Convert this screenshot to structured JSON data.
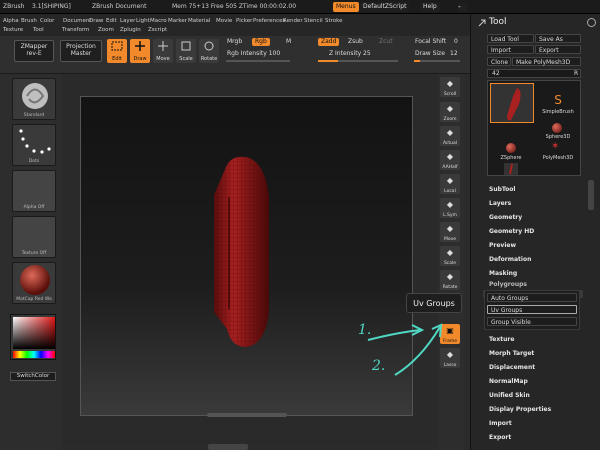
{
  "titlebar": {
    "app": "ZBrush",
    "version": "3.1[SHIPING]",
    "document": "ZBrush Document",
    "mem": "Mem 75+13 Free 505 ZTime 00:00:02.00",
    "menus_label": "Menus",
    "script_label": "DefaultZScript",
    "help_label": "Help"
  },
  "menubar": {
    "row1": [
      "Alpha",
      "Brush",
      "Color",
      "Document",
      "Draw",
      "Edit",
      "Layer",
      "Light",
      "Macro",
      "Marker",
      "Material",
      "Movie",
      "Picker",
      "Preferences",
      "Render",
      "Stencil",
      "Stroke"
    ],
    "row2": [
      "Texture",
      "Tool",
      "Transform",
      "Zoom",
      "Zplugin",
      "Zscript"
    ]
  },
  "toolbar": {
    "zmapper": "ZMapper",
    "zmapper_rev": "rev-E",
    "projection": "Projection",
    "projection2": "Master",
    "edit": "Edit",
    "draw": "Draw",
    "move": "Move",
    "scale": "Scale",
    "rotate": "Rotate",
    "mrgb": "Mrgb",
    "rgb": "Rgb",
    "m": "M",
    "rgb_intensity": "Rgb Intensity 100",
    "zadd": "Zadd",
    "zsub": "Zsub",
    "zcut": "Zcut",
    "z_intensity": "Z Intensity 25",
    "focal_shift": "Focal Shift",
    "focal_shift_val": "0",
    "draw_size": "Draw Size",
    "draw_size_val": "12"
  },
  "leftshelf": {
    "brush": "Standard",
    "stroke": "Dots",
    "alpha": "Alpha Off",
    "texture": "Texture Off",
    "material": "MatCap Red Wa",
    "switch_color": "SwitchColor"
  },
  "rightshelf": [
    "Scroll",
    "Zoom",
    "Actual",
    "AAHalf",
    "Local",
    "L.Sym",
    "Move",
    "Scale",
    "Rotate",
    "Frame",
    "Lasso"
  ],
  "rightshelf_xyz": "XYZ",
  "tooltip": "Uv Groups",
  "tray": {
    "title": "Tool",
    "load_tool": "Load Tool",
    "save_as": "Save As",
    "import": "Import",
    "export": "Export",
    "clone": "Clone",
    "make_polymesh": "Make PolyMesh3D",
    "slider_val": "42",
    "slider_r": "R",
    "thumbs": [
      "SimpleBrush",
      "Sphere3D",
      "ZSphere",
      "PolyMesh3D"
    ],
    "items_top": [
      "SubTool",
      "Layers",
      "Geometry",
      "Geometry HD",
      "Preview",
      "Deformation",
      "Masking"
    ],
    "polygroups": "Polygroups",
    "poly_buttons": [
      "Auto Groups",
      "Uv Groups",
      "Group Visible"
    ],
    "items_bottom": [
      "Texture",
      "Morph Target",
      "Displacement",
      "NormalMap",
      "Unified Skin",
      "Display Properties",
      "Import",
      "Export"
    ]
  },
  "annotations": {
    "one": "1.",
    "two": "2."
  },
  "colors": {
    "accent": "#f28a2c",
    "annotation": "#4fd8c4",
    "mesh": "#8b1a1a"
  }
}
